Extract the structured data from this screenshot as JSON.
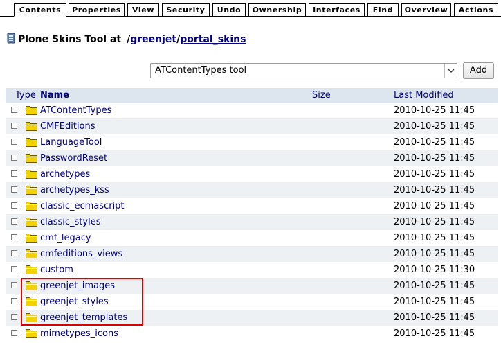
{
  "tabs": [
    {
      "label": "Contents",
      "active": true
    },
    {
      "label": "Properties"
    },
    {
      "label": "View"
    },
    {
      "label": "Security"
    },
    {
      "label": "Undo"
    },
    {
      "label": "Ownership"
    },
    {
      "label": "Interfaces"
    },
    {
      "label": "Find"
    },
    {
      "label": "Overview"
    },
    {
      "label": "Actions"
    }
  ],
  "heading": {
    "title": "Plone Skins Tool at",
    "path_root": "/",
    "crumb1": "greenjet",
    "sep": "/",
    "crumb2": "portal_skins"
  },
  "add_form": {
    "selected": "ATContentTypes tool",
    "add_label": "Add"
  },
  "table": {
    "headers": {
      "type": "Type",
      "name": "Name",
      "size": "Size",
      "modified": "Last Modified"
    },
    "rows": [
      {
        "name": "ATContentTypes",
        "modified": "2010-10-25 11:45"
      },
      {
        "name": "CMFEditions",
        "modified": "2010-10-25 11:45"
      },
      {
        "name": "LanguageTool",
        "modified": "2010-10-25 11:45"
      },
      {
        "name": "PasswordReset",
        "modified": "2010-10-25 11:45"
      },
      {
        "name": "archetypes",
        "modified": "2010-10-25 11:45"
      },
      {
        "name": "archetypes_kss",
        "modified": "2010-10-25 11:45"
      },
      {
        "name": "classic_ecmascript",
        "modified": "2010-10-25 11:45"
      },
      {
        "name": "classic_styles",
        "modified": "2010-10-25 11:45"
      },
      {
        "name": "cmf_legacy",
        "modified": "2010-10-25 11:45"
      },
      {
        "name": "cmfeditions_views",
        "modified": "2010-10-25 11:45"
      },
      {
        "name": "custom",
        "modified": "2010-10-25 11:30"
      },
      {
        "name": "greenjet_images",
        "modified": "2010-10-25 11:45"
      },
      {
        "name": "greenjet_styles",
        "modified": "2010-10-25 11:45"
      },
      {
        "name": "greenjet_templates",
        "modified": "2010-10-25 11:45"
      },
      {
        "name": "mimetypes_icons",
        "modified": "2010-10-25 11:45"
      }
    ]
  },
  "colors": {
    "link": "#000080",
    "header_bg": "#dde6ee",
    "alt_row_bg": "#eef1f4",
    "highlight": "#e00000",
    "folder": "#f2d200"
  }
}
